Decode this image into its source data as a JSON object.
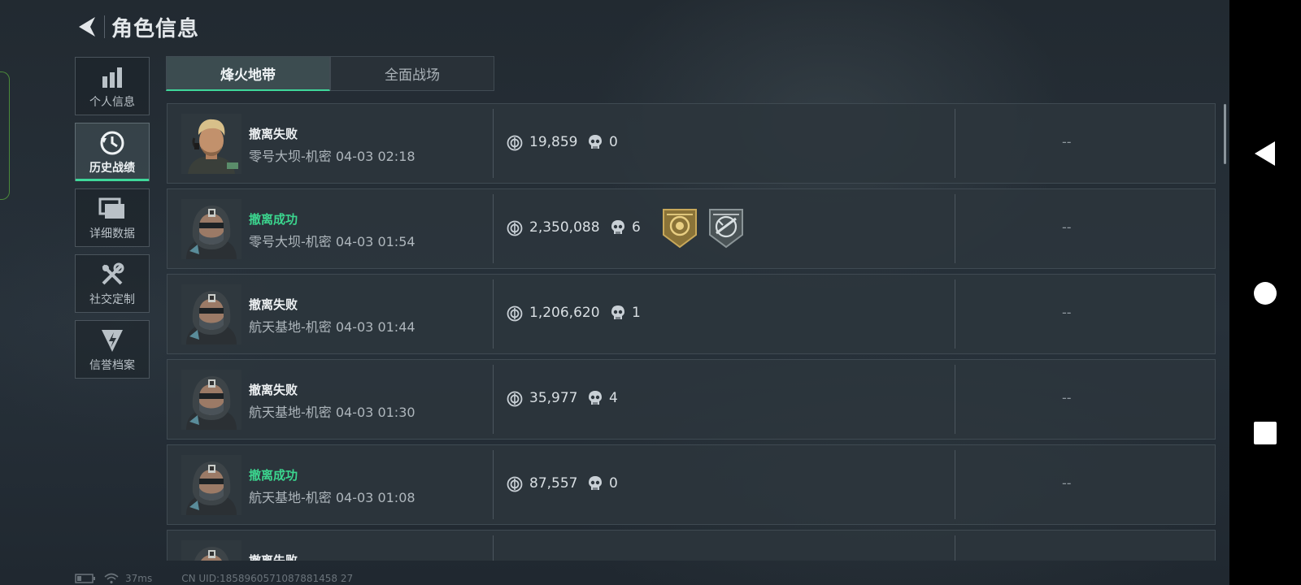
{
  "header": {
    "title": "角色信息"
  },
  "nav": {
    "items": [
      {
        "label": "个人信息",
        "active": false
      },
      {
        "label": "历史战绩",
        "active": true
      },
      {
        "label": "详细数据",
        "active": false
      },
      {
        "label": "社交定制",
        "active": false
      },
      {
        "label": "信誉档案",
        "active": false
      }
    ]
  },
  "tabs": [
    {
      "label": "烽火地带",
      "active": true
    },
    {
      "label": "全面战场",
      "active": false
    }
  ],
  "records": [
    {
      "status": "撤离失败",
      "success": false,
      "meta": "零号大坝-机密 04-03 02:18",
      "money": "19,859",
      "kills": "0",
      "result": "--",
      "avatar": "blond"
    },
    {
      "status": "撤离成功",
      "success": true,
      "meta": "零号大坝-机密 04-03 01:54",
      "money": "2,350,088",
      "kills": "6",
      "result": "--",
      "avatar": "hood",
      "badges": [
        {
          "icon": "gold-emblem-badge-icon"
        },
        {
          "icon": "crossed-rifle-badge-icon"
        }
      ]
    },
    {
      "status": "撤离失败",
      "success": false,
      "meta": "航天基地-机密 04-03 01:44",
      "money": "1,206,620",
      "kills": "1",
      "result": "--",
      "avatar": "hood"
    },
    {
      "status": "撤离失败",
      "success": false,
      "meta": "航天基地-机密 04-03 01:30",
      "money": "35,977",
      "kills": "4",
      "result": "--",
      "avatar": "hood"
    },
    {
      "status": "撤离成功",
      "success": true,
      "meta": "航天基地-机密 04-03 01:08",
      "money": "87,557",
      "kills": "0",
      "result": "--",
      "avatar": "hood"
    },
    {
      "status": "撤离失败",
      "success": false,
      "meta": "",
      "money": "",
      "kills": "",
      "result": "",
      "avatar": "hood"
    }
  ],
  "statusbar": {
    "ping": "37ms",
    "uid": "CN UID:1858960571087881458 27"
  },
  "colors": {
    "accent": "#3fd79a",
    "success": "#3bd58e"
  }
}
